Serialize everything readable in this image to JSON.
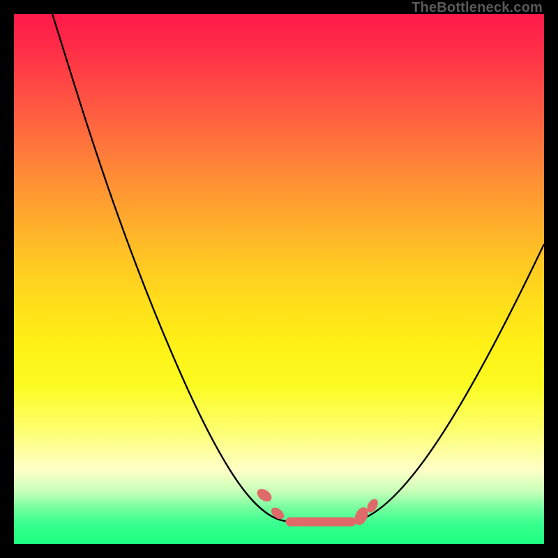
{
  "attribution": "TheBottleneck.com",
  "chart_data": {
    "type": "line",
    "title": "",
    "xlabel": "",
    "ylabel": "",
    "xlim": [
      0,
      100
    ],
    "ylim": [
      0,
      100
    ],
    "background": "vertical-gradient red→yellow→green (value heatmap)",
    "series": [
      {
        "name": "bottleneck-curve",
        "x": [
          7,
          12,
          20,
          28,
          35,
          42,
          47,
          51,
          55,
          60,
          64,
          70,
          78,
          88,
          100
        ],
        "y": [
          100,
          86,
          68,
          52,
          38,
          24,
          14,
          6,
          4,
          4,
          5,
          10,
          22,
          40,
          57
        ]
      }
    ],
    "markers": {
      "name": "highlight-points",
      "color": "#e06a6a",
      "x": [
        47,
        49.5,
        55,
        60,
        64,
        66,
        68
      ],
      "y": [
        9,
        6,
        4,
        4,
        5,
        6,
        8
      ]
    },
    "notes": "V-shaped curve; minimum (optimal / no-bottleneck zone) around x≈55–64 where y≈4. Salmon blobs emphasize the low region. No axis ticks or numeric labels are rendered."
  }
}
